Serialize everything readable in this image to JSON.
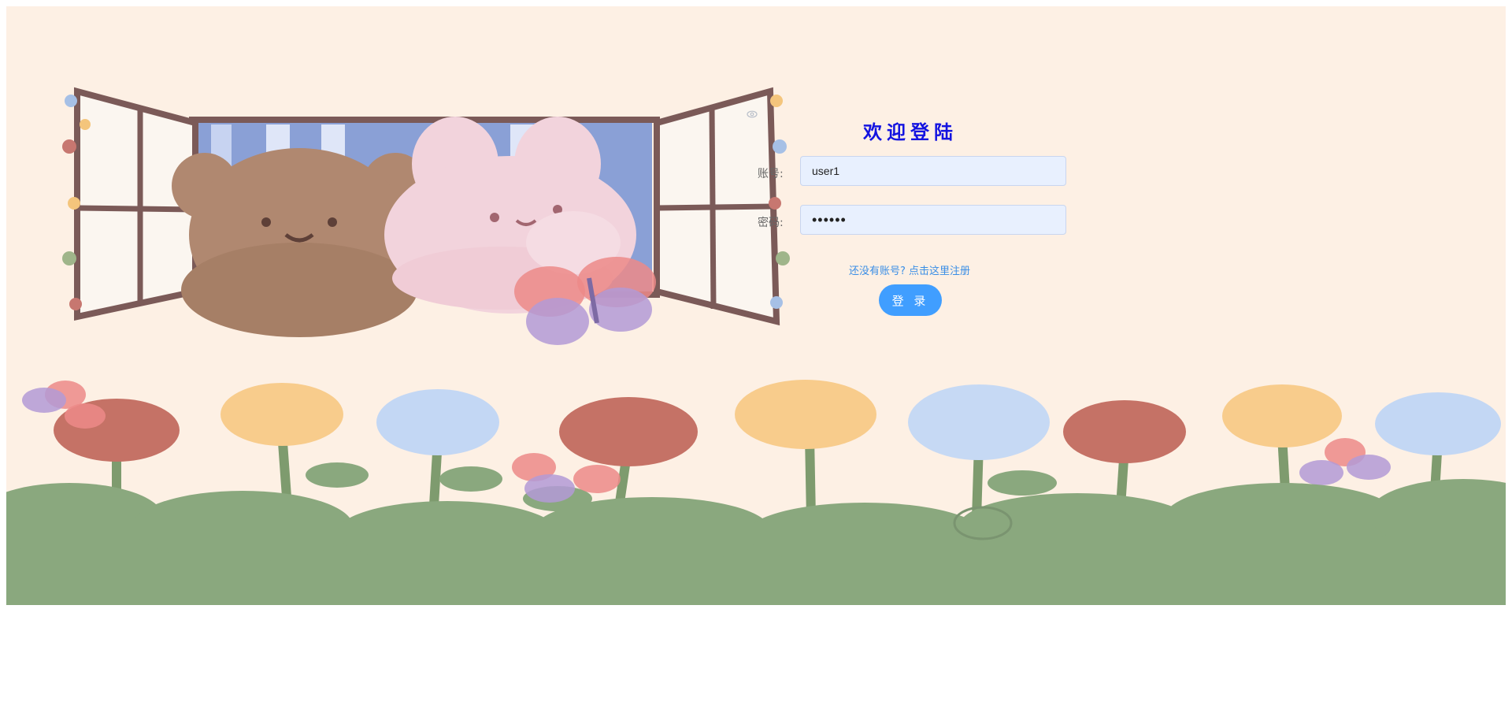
{
  "form": {
    "title": "欢迎登陆",
    "account_label": "账号:",
    "account_value": "user1",
    "password_label": "密码:",
    "password_value": "••••••",
    "register_link": "还没有账号? 点击这里注册",
    "login_button": "登 录"
  },
  "icons": {
    "password_toggle": "eye-icon"
  },
  "colors": {
    "background": "#fdf0e4",
    "title": "#1414e0",
    "link": "#3a8ee6",
    "button": "#409eff",
    "input_bg": "#e8f0fe",
    "grass": "#8aa87e"
  }
}
